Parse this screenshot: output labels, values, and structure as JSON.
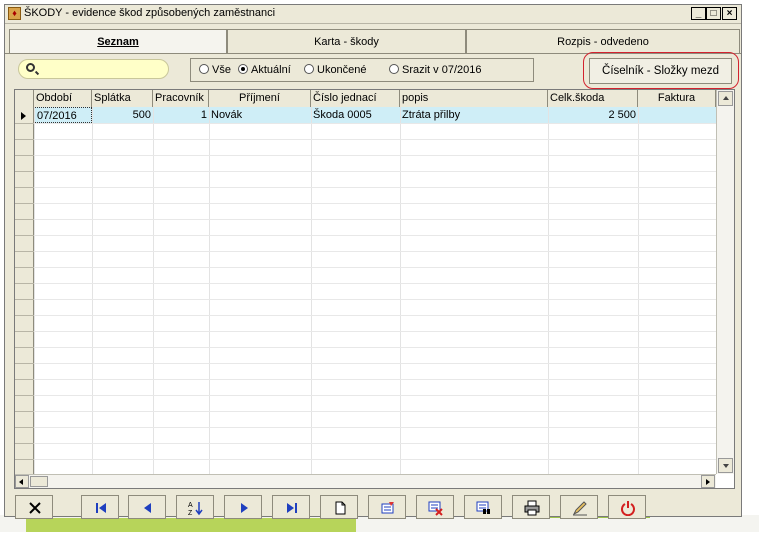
{
  "window": {
    "title": "ŠKODY - evidence škod způsobených zaměstnanci"
  },
  "titlebar_buttons": {
    "minimize": "_",
    "maximize": "□",
    "close": "×"
  },
  "tabs": [
    {
      "label": "Seznam",
      "active": true
    },
    {
      "label": "Karta - škody",
      "active": false
    },
    {
      "label": "Rozpis - odvedeno",
      "active": false
    }
  ],
  "search": {
    "value": "",
    "placeholder": ""
  },
  "filter": {
    "options": [
      {
        "label": "Vše",
        "selected": false
      },
      {
        "label": "Aktuální",
        "selected": true
      },
      {
        "label": "Ukončené",
        "selected": false
      },
      {
        "label": "Srazit v 07/2016",
        "selected": false
      }
    ]
  },
  "ciselnik_button": {
    "label": "Číselník - Složky mezd"
  },
  "grid": {
    "columns": [
      "Období",
      "Splátka",
      "Pracovník",
      "Příjmení",
      "Číslo jednací",
      "popis",
      "Celk.škoda",
      "Faktura"
    ],
    "rows": [
      {
        "obdobi": "07/2016",
        "splatka": "500",
        "pracovnik": "1",
        "prijmeni": "Novák",
        "cislo": "Škoda 0005",
        "popis": "Ztráta přilby",
        "celk": "2 500",
        "faktura": ""
      }
    ]
  },
  "toolbar": [
    {
      "icon": "cancel-x-icon"
    },
    {
      "icon": "first-record-icon"
    },
    {
      "icon": "previous-record-icon"
    },
    {
      "icon": "sort-az-icon"
    },
    {
      "icon": "next-record-icon"
    },
    {
      "icon": "last-record-icon"
    },
    {
      "icon": "new-document-icon"
    },
    {
      "icon": "edit-record-icon"
    },
    {
      "icon": "delete-record-icon"
    },
    {
      "icon": "find-record-icon"
    },
    {
      "icon": "print-icon"
    },
    {
      "icon": "pen-tool-icon"
    },
    {
      "icon": "power-exit-icon"
    }
  ],
  "colors": {
    "selected_row": "#cfeef7",
    "search_bg": "#ffffc8",
    "highlight_ring": "#d3232f",
    "nav_blue": "#1f3fbf",
    "power_red": "#d32020"
  }
}
